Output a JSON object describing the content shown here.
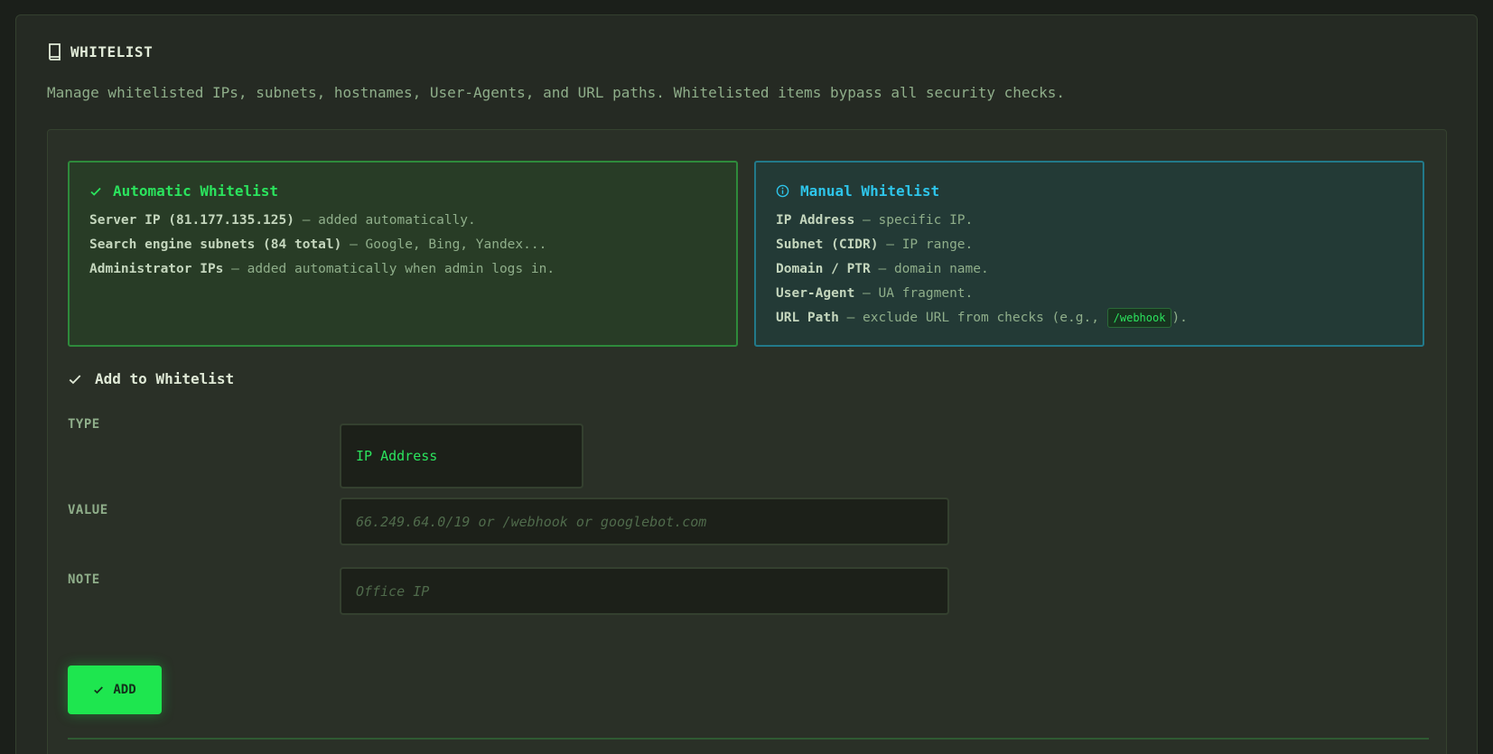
{
  "header": {
    "title": "WHITELIST",
    "description": "Manage whitelisted IPs, subnets, hostnames, User-Agents, and URL paths. Whitelisted items bypass all security checks."
  },
  "automatic": {
    "title": "Automatic Whitelist",
    "lines": [
      {
        "label": "Server IP (81.177.135.125)",
        "text": " — added automatically."
      },
      {
        "label": "Search engine subnets (84 total)",
        "text": " — Google, Bing, Yandex..."
      },
      {
        "label": "Administrator IPs",
        "text": " — added automatically when admin logs in."
      }
    ]
  },
  "manual": {
    "title": "Manual Whitelist",
    "lines": [
      {
        "label": "IP Address",
        "text": " — specific IP."
      },
      {
        "label": "Subnet (CIDR)",
        "text": " — IP range."
      },
      {
        "label": "Domain / PTR",
        "text": " — domain name."
      },
      {
        "label": "User-Agent",
        "text": " — UA fragment."
      },
      {
        "label": "URL Path",
        "text": " — exclude URL from checks (e.g., ",
        "code": "/webhook",
        "suffix": ")."
      }
    ]
  },
  "form": {
    "section_title": "Add to Whitelist",
    "type_label": "TYPE",
    "type_value": "IP Address",
    "value_label": "VALUE",
    "value_placeholder": "66.249.64.0/19 or /webhook or googlebot.com",
    "note_label": "NOTE",
    "note_placeholder": "Office IP",
    "add_label": "ADD"
  },
  "colors": {
    "accent_green": "#1ee64f",
    "accent_cyan": "#2ec5ea",
    "background": "#1b1f1a"
  }
}
